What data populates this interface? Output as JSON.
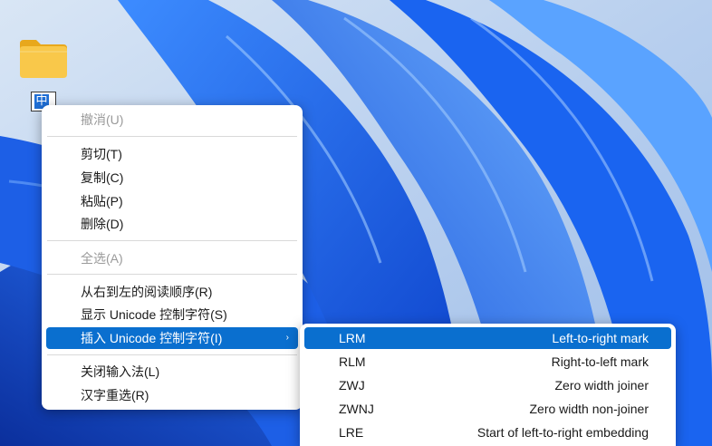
{
  "desktop": {
    "ime_char": "中"
  },
  "main_menu": {
    "items": [
      {
        "label": "撤消(U)"
      },
      {
        "label": "剪切(T)"
      },
      {
        "label": "复制(C)"
      },
      {
        "label": "粘贴(P)"
      },
      {
        "label": "删除(D)"
      },
      {
        "label": "全选(A)"
      },
      {
        "label": "从右到左的阅读顺序(R)"
      },
      {
        "label": "显示 Unicode 控制字符(S)"
      },
      {
        "label": "插入 Unicode 控制字符(I)"
      },
      {
        "label": "关闭输入法(L)"
      },
      {
        "label": "汉字重选(R)"
      }
    ],
    "submenu_arrow": "›"
  },
  "sub_menu": {
    "items": [
      {
        "code": "LRM",
        "description": "Left-to-right mark"
      },
      {
        "code": "RLM",
        "description": "Right-to-left mark"
      },
      {
        "code": "ZWJ",
        "description": "Zero width joiner"
      },
      {
        "code": "ZWNJ",
        "description": "Zero width non-joiner"
      },
      {
        "code": "LRE",
        "description": "Start of left-to-right embedding"
      }
    ]
  },
  "colors": {
    "highlight": "#0a6fcf",
    "wallpaper_base": "#0a3fb8",
    "disabled_text": "#9a9a9a"
  }
}
